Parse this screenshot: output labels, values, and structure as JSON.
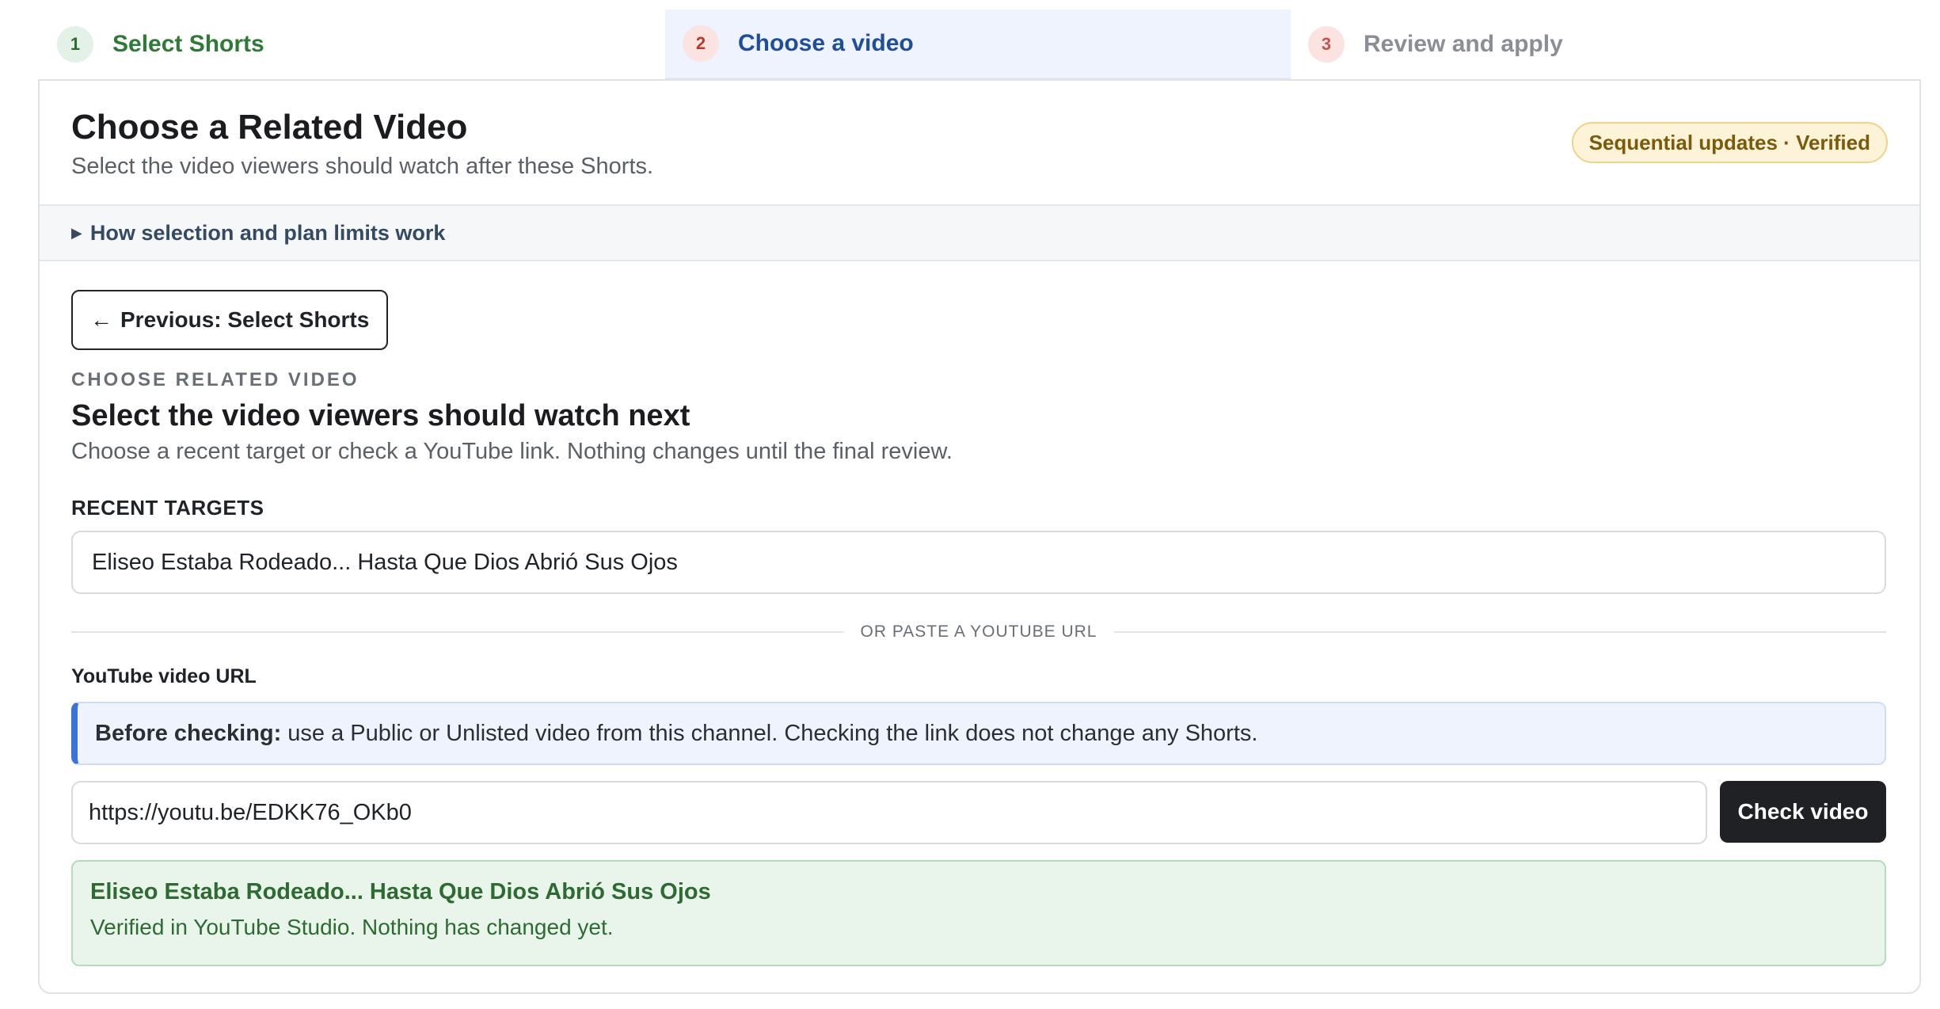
{
  "stepper": {
    "steps": [
      {
        "number": "1",
        "label": "Select Shorts",
        "state": "complete"
      },
      {
        "number": "2",
        "label": "Choose a video",
        "state": "active"
      },
      {
        "number": "3",
        "label": "Review and apply",
        "state": "upcoming"
      }
    ]
  },
  "header": {
    "title": "Choose a Related Video",
    "subtitle": "Select the video viewers should watch after these Shorts.",
    "badge": "Sequential updates · Verified"
  },
  "disclosure": {
    "label": "How selection and plan limits work"
  },
  "main": {
    "previous_button": "Previous: Select Shorts",
    "eyebrow": "CHOOSE RELATED VIDEO",
    "title": "Select the video viewers should watch next",
    "description": "Choose a recent target or check a YouTube link. Nothing changes until the final review.",
    "recent_label": "RECENT TARGETS",
    "recent_selected": "Eliseo Estaba Rodeado... Hasta Que Dios Abrió Sus Ojos",
    "divider_text": "OR PASTE A YOUTUBE URL",
    "url_label": "YouTube video URL",
    "info_strong": "Before checking:",
    "info_text": "use a Public or Unlisted video from this channel. Checking the link does not change any Shorts.",
    "url_value": "https://youtu.be/EDKK76_OKb0",
    "check_button": "Check video",
    "result_title": "Eliseo Estaba Rodeado... Hasta Que Dios Abrió Sus Ojos",
    "result_text": "Verified in YouTube Studio. Nothing has changed yet."
  },
  "colors": {
    "accent_blue": "#3b73d9",
    "success_green": "#2e6b33",
    "badge_bg": "#fcf3d8",
    "primary_dark": "#1f2124"
  },
  "icons": {
    "disclosure": "triangle-right-icon",
    "previous": "arrow-left-icon"
  }
}
